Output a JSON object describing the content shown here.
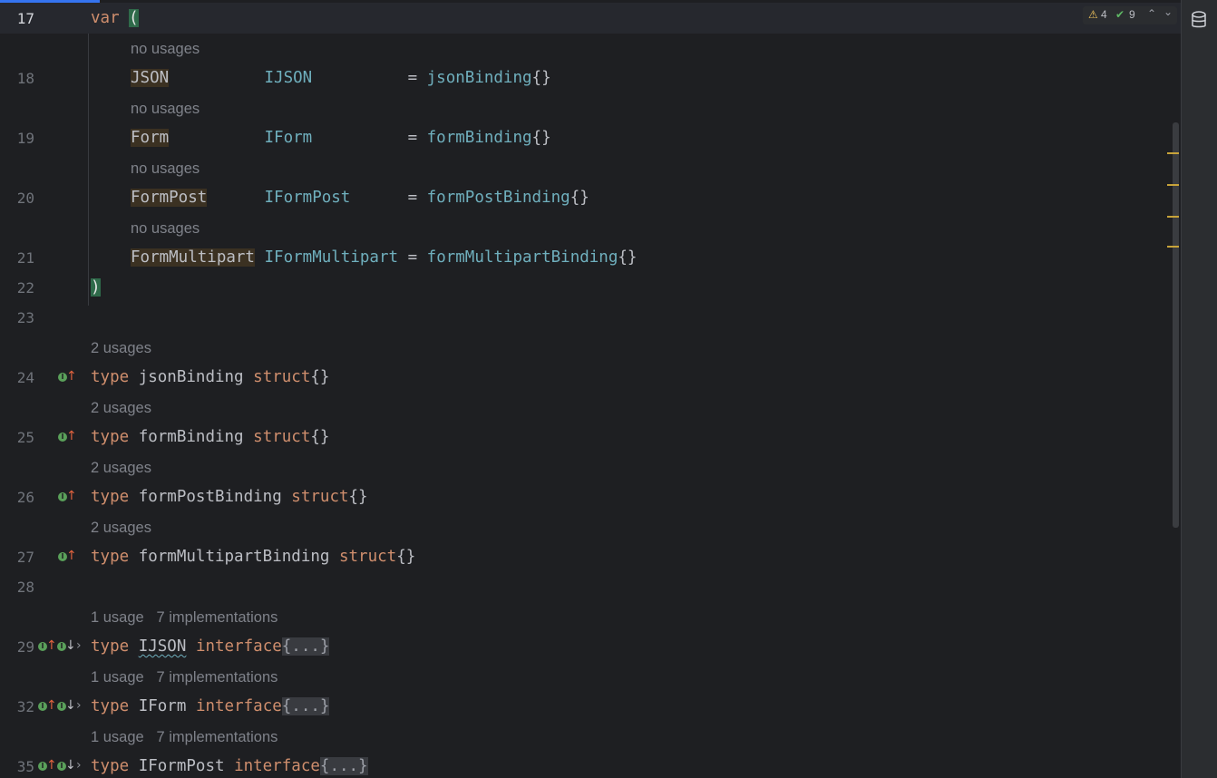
{
  "editor": {
    "inspection_widget": {
      "warnings": "4",
      "checks": "9",
      "up_label": "^",
      "down_label": "v"
    },
    "hints": {
      "no_usages": "no usages",
      "two_usages": "2 usages",
      "one_usage": "1 usage",
      "impls": "7 implementations"
    },
    "lines": {
      "l17": "17",
      "l18": "18",
      "l19": "19",
      "l20": "20",
      "l21": "21",
      "l22": "22",
      "l23": "23",
      "l24": "24",
      "l25": "25",
      "l26": "26",
      "l27": "27",
      "l28": "28",
      "l29": "29",
      "l32": "32",
      "l35": "35"
    },
    "code": {
      "var_kw": "var",
      "open_paren": "(",
      "close_paren": ")",
      "vars": [
        {
          "name": "JSON",
          "type": "IJSON",
          "pad1": "          ",
          "pad2": "          ",
          "eq": "= ",
          "fn": "jsonBinding",
          "tail": "{}"
        },
        {
          "name": "Form",
          "type": "IForm",
          "pad1": "          ",
          "pad2": "          ",
          "eq": "= ",
          "fn": "formBinding",
          "tail": "{}"
        },
        {
          "name": "FormPost",
          "type": "IFormPost",
          "pad1": "      ",
          "pad2": "      ",
          "eq": "= ",
          "fn": "formPostBinding",
          "tail": "{}"
        },
        {
          "name": "FormMultipart",
          "type": "IFormMultipart",
          "pad1": " ",
          "pad2": " ",
          "eq": "= ",
          "fn": "formMultipartBinding",
          "tail": "{}"
        }
      ],
      "type_kw": "type",
      "struct_kw": "struct",
      "interface_kw": "interface",
      "empty_braces": "{}",
      "folded": "{...}",
      "structs": [
        "jsonBinding",
        "formBinding",
        "formPostBinding",
        "formMultipartBinding"
      ],
      "interfaces": [
        "IJSON",
        "IForm",
        "IFormPost"
      ]
    }
  }
}
